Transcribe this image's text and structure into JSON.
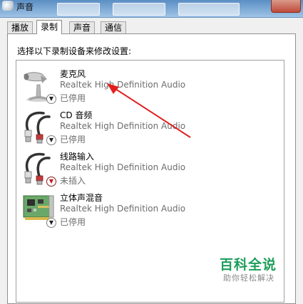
{
  "window": {
    "title": "声音"
  },
  "tabs": [
    {
      "label": "播放"
    },
    {
      "label": "录制"
    },
    {
      "label": "声音"
    },
    {
      "label": "通信"
    }
  ],
  "active_tab": "录制",
  "instruction": "选择以下录制设备来修改设置:",
  "devices": [
    {
      "name": "麦克风",
      "driver": "Realtek High Definition Audio",
      "status": "已停用",
      "icon": "microphone-icon",
      "badge": "disabled-arrow-icon"
    },
    {
      "name": "CD 音频",
      "driver": "Realtek High Definition Audio",
      "status": "已停用",
      "icon": "audio-cable-icon",
      "badge": "disabled-arrow-icon"
    },
    {
      "name": "线路输入",
      "driver": "Realtek High Definition Audio",
      "status": "未插入",
      "icon": "audio-cable-icon",
      "badge": "unplugged-arrow-icon"
    },
    {
      "name": "立体声混音",
      "driver": "Realtek High Definition Audio",
      "status": "已停用",
      "icon": "sound-card-icon",
      "badge": "disabled-arrow-icon"
    }
  ],
  "watermark": {
    "title": "百科全说",
    "subtitle": "助你轻松解决"
  },
  "colors": {
    "annotation_arrow": "#e02020",
    "watermark": "#1e9e5a",
    "title_bar": "#5b8fc4"
  }
}
